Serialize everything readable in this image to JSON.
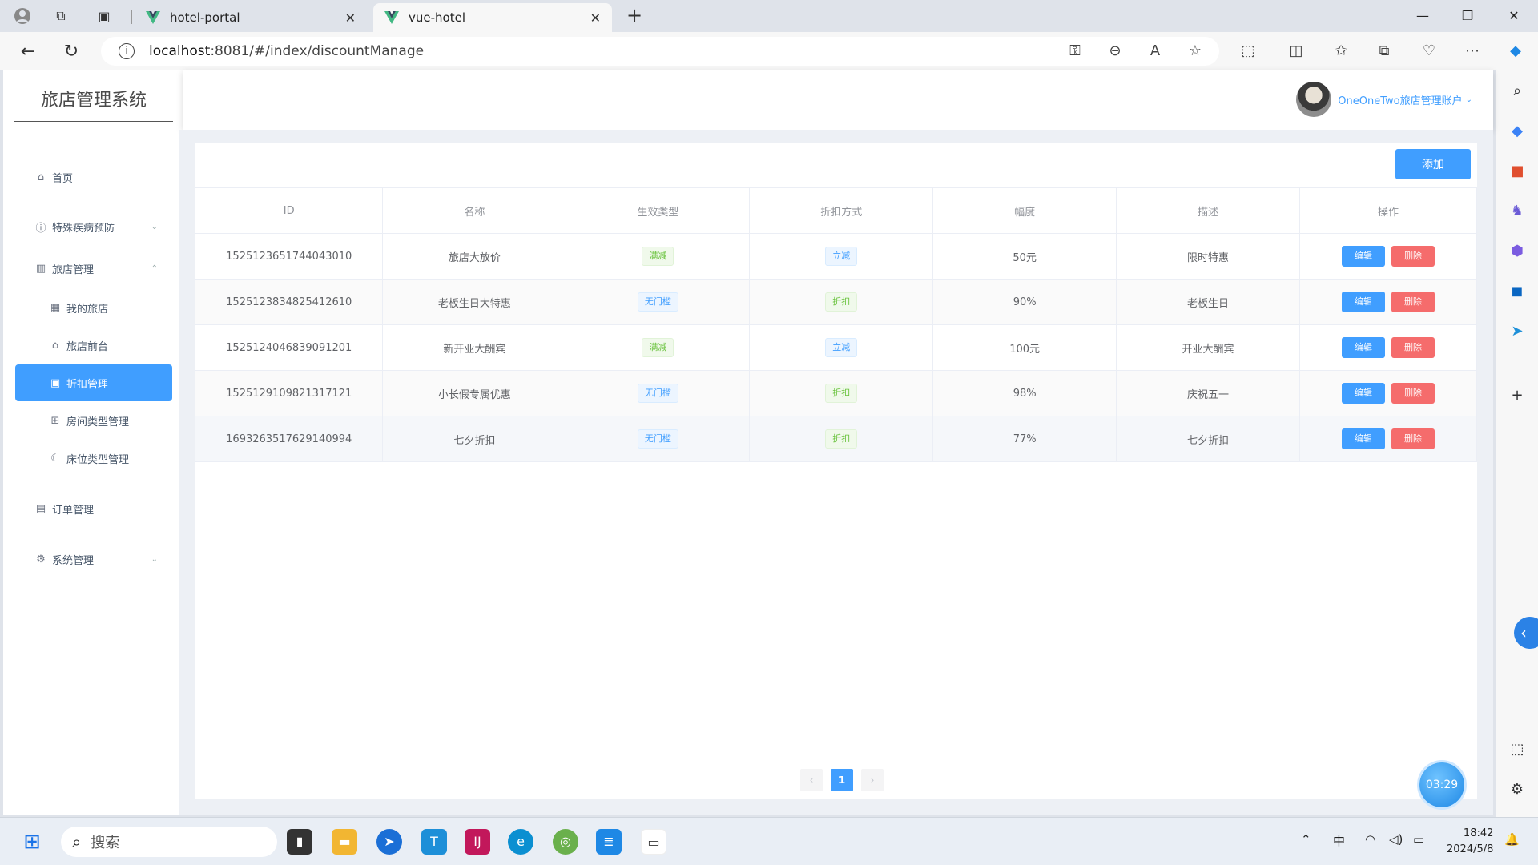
{
  "browser": {
    "tabs": [
      {
        "title": "hotel-portal",
        "active": false
      },
      {
        "title": "vue-hotel",
        "active": true
      }
    ],
    "url_host": "localhost",
    "url_rest": ":8081/#/index/discountManage"
  },
  "sidebar": {
    "logo": "旅店管理系统",
    "items": [
      {
        "label": "首页",
        "icon": "home-icon"
      },
      {
        "label": "特殊疾病预防",
        "icon": "info-circle-icon"
      },
      {
        "label": "旅店管理",
        "icon": "building-icon"
      },
      {
        "label": "我的旅店",
        "icon": "office-icon"
      },
      {
        "label": "旅店前台",
        "icon": "house-fill-icon"
      },
      {
        "label": "折扣管理",
        "icon": "discount-icon",
        "active": true
      },
      {
        "label": "房间类型管理",
        "icon": "grid-icon"
      },
      {
        "label": "床位类型管理",
        "icon": "moon-icon"
      },
      {
        "label": "订单管理",
        "icon": "clipboard-icon"
      },
      {
        "label": "系统管理",
        "icon": "gear-icon"
      }
    ]
  },
  "header": {
    "username": "OneOneTwo旅店管理账户"
  },
  "toolbar": {
    "add_label": "添加"
  },
  "table": {
    "columns": [
      "ID",
      "名称",
      "生效类型",
      "折扣方式",
      "幅度",
      "描述",
      "操作"
    ],
    "rows": [
      {
        "id": "1525123651744043010",
        "name": "旅店大放价",
        "effect": "满减",
        "effect_color": "green",
        "method": "立减",
        "method_color": "blue",
        "amount": "50元",
        "desc": "限时特惠"
      },
      {
        "id": "1525123834825412610",
        "name": "老板生日大特惠",
        "effect": "无门槛",
        "effect_color": "blue",
        "method": "折扣",
        "method_color": "green",
        "amount": "90%",
        "desc": "老板生日"
      },
      {
        "id": "1525124046839091201",
        "name": "新开业大酬宾",
        "effect": "满减",
        "effect_color": "green",
        "method": "立减",
        "method_color": "blue",
        "amount": "100元",
        "desc": "开业大酬宾"
      },
      {
        "id": "1525129109821317121",
        "name": "小长假专属优惠",
        "effect": "无门槛",
        "effect_color": "blue",
        "method": "折扣",
        "method_color": "green",
        "amount": "98%",
        "desc": "庆祝五一"
      },
      {
        "id": "1693263517629140994",
        "name": "七夕折扣",
        "effect": "无门槛",
        "effect_color": "blue",
        "method": "折扣",
        "method_color": "green",
        "amount": "77%",
        "desc": "七夕折扣"
      }
    ],
    "edit_label": "编辑",
    "delete_label": "删除"
  },
  "pagination": {
    "prev": "‹",
    "current": "1",
    "next": "›"
  },
  "timer": "03:29",
  "taskbar": {
    "search_placeholder": "搜索",
    "ime": "中",
    "time": "18:42",
    "date": "2024/5/8"
  },
  "colors": {
    "primary": "#409eff",
    "danger": "#f56c6c",
    "success": "#67c23a"
  }
}
